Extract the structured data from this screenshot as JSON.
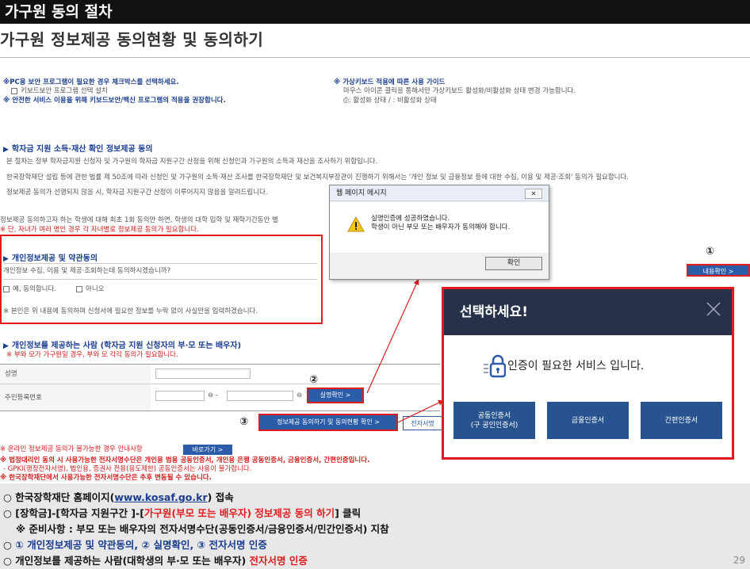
{
  "header": {
    "title": "가구원 동의 절차",
    "subtitle": "가구원 정보제공 동의현황 및 동의하기"
  },
  "notices": {
    "left_line1": "※PC용 보안 프로그램이 필요한 경우 체크박스를 선택하세요.",
    "left_line2": "키보드보안 프로그램 선택 설치",
    "left_line3": "※ 안전한 서비스 이용을 위해 키보드보안/백신 프로그램의 적용을 권장합니다.",
    "right_line1": "※ 가상키보드 적용에 따른 사용 가이드",
    "right_line2": "마우스 아이콘 클릭을 통해서만 가상키보드 활성화/비활성화 상태 변경 가능합니다.",
    "right_line3": ": 활성화 상태 / : 비활성화 상태"
  },
  "section1": {
    "title": "학자금 지원 소득·재산 확인 정보제공 동의",
    "p1": "본 절차는 정부 학자금지원 신청자 및 가구원의 학자금 지원구간 산정을 위해 신청인과 가구원의 소득과 재산을 조사하기 위함입니다.",
    "p2": "한국장학재단 설립 등에 관한 법률 제 50조에 따라 신청인 및 가구원의 소득·재산 조사를 한국장학재단 및 보건복지부장관이 진행하기 위해서는 '개인 정보 및 금융정보 등에 대한 수집, 이용 및 제공·조회' 동의가 필요합니다.",
    "p3": "정보제공 동의가 선행되지 않을 시, 학자금 지원구간 산정이 이루어지지 않음을 알려드립니다.",
    "p4": "정보제공 동의하고자 하는 학생에 대해 최초 1회 동의만 하면, 학생의 대학 입학 및 재학기간동안 별",
    "p5": "※ 단, 자녀가 여러 명인 경우 각 자녀별로 정보제공 동의가 필요합니다."
  },
  "section2": {
    "title": "개인정보제공 및 약관동의",
    "question": "개인정보 수집, 이용 및 제공·조회하는데 동의하시겠습니까?",
    "agree": "예, 동의합니다.",
    "disagree": "아니오",
    "note": "※ 본인은 위 내용에 동의하며 신청서에 필요한 정보를 누락 없이 사실만을 입력하겠습니다."
  },
  "section3": {
    "title": "개인정보를 제공하는 사람 (학자금 지원 신청자의 부·모 또는 배우자)",
    "note": "※ 부와 모가 가구원일 경우, 부와 모 각각 동의가 필요합니다.",
    "name_label": "성명",
    "rrn_label": "주민등록번호",
    "rrn_sep": "-",
    "verify_button": "실명확인 >",
    "consent_button": "정보제공 동의하기 및 동의현황 확인 >",
    "esign_button": "전자서명",
    "view_button": "내용확인 >"
  },
  "footer_notes": {
    "n1": "※ 온라인 정보제공 동의가 불가능한 경우 안내사항",
    "go_button": "바로가기 >",
    "n2": "※ 법정대리인 동의 시 사용가능한 전자서명수단은 개인용 범용 공동인증서, 개인용 은행 공동인증서, 금융인증서, 간편인증입니다.",
    "n3": "- GPKI(행정전자서명), 법인용, 증권사 전용(용도제한) 공동인증서는 사용이 불가합니다.",
    "n4": "※ 한국장학재단에서 사용가능한 전자서명수단은 추후 변동될 수 있습니다."
  },
  "dialog": {
    "title": "웹 페이지 메시지",
    "line1": "실명인증에 성공하였습니다.",
    "line2": "학생이 아닌 부모 또는 배우자가 동의해야 합니다.",
    "ok": "확인"
  },
  "cert_modal": {
    "title": "선택하세요!",
    "message": "인증이 필요한 서비스 입니다.",
    "btn1_line1": "공동인증서",
    "btn1_line2": "(구 공인인증서)",
    "btn2": "금융인증서",
    "btn3": "간편인증서"
  },
  "markers": {
    "m1": "①",
    "m2": "②",
    "m3": "③"
  },
  "instructions": {
    "l1_prefix": "○ 한국장학재단 홈페이지(",
    "l1_link": "www.kosaf.go.kr",
    "l1_suffix": ") 접속",
    "l2_prefix": "○ [장학금]-[학자금 지원구간 ]-[",
    "l2_red": "가구원(부모 또는 배우자) 정보제공 동의 하기",
    "l2_suffix": "] 클릭",
    "l3": "※ 준비사항 : 부모 또는 배우자의 전자서명수단(공동인증서/금융인증서/민간인증서) 지참",
    "l4_prefix": "○ ",
    "l4_blue": "① 개인정보제공 및 약관동의, ② 실명확인, ③ 전자서명 인증",
    "l5_prefix": "○ 개인정보를 제공하는 사람(대학생의 부·모 또는 배우자) ",
    "l5_red": "전자서명 인증"
  },
  "page_number": "29",
  "colors": {
    "accent_red": "#e01c1c",
    "navy": "#27324a",
    "blue": "#2b5ca8"
  }
}
